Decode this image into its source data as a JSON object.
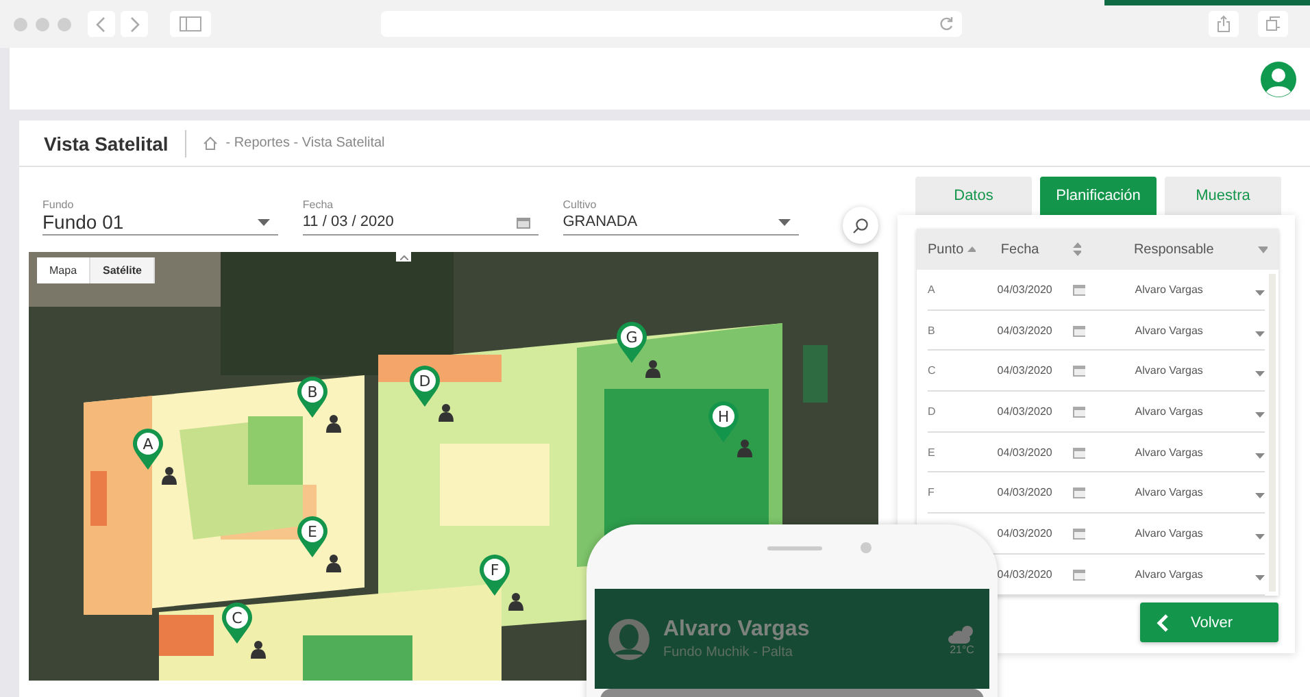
{
  "page": {
    "title": "Vista Satelital",
    "breadcrumb": "- Reportes - Vista Satelital"
  },
  "filters": [
    {
      "label": "Fundo",
      "value": "Fundo 01",
      "kind": "select"
    },
    {
      "label": "Fecha",
      "value": "11 / 03 / 2020",
      "kind": "date"
    },
    {
      "label": "Cultivo",
      "value": "GRANADA",
      "kind": "select"
    }
  ],
  "map": {
    "toggles": [
      {
        "label": "Mapa",
        "selected": false
      },
      {
        "label": "Satélite",
        "selected": true
      }
    ],
    "pins": [
      {
        "label": "A"
      },
      {
        "label": "B"
      },
      {
        "label": "C"
      },
      {
        "label": "D"
      },
      {
        "label": "E"
      },
      {
        "label": "F"
      },
      {
        "label": "G"
      },
      {
        "label": "H"
      }
    ]
  },
  "tabs": [
    {
      "label": "Datos",
      "selected": false
    },
    {
      "label": "Planificación",
      "selected": true
    },
    {
      "label": "Muestra",
      "selected": false
    }
  ],
  "table": {
    "columns": [
      "Punto",
      "Fecha",
      "Responsable"
    ],
    "rows": [
      {
        "punto": "A",
        "fecha": "04/03/2020",
        "responsable": "Alvaro Vargas"
      },
      {
        "punto": "B",
        "fecha": "04/03/2020",
        "responsable": "Alvaro Vargas"
      },
      {
        "punto": "C",
        "fecha": "04/03/2020",
        "responsable": "Alvaro Vargas"
      },
      {
        "punto": "D",
        "fecha": "04/03/2020",
        "responsable": "Alvaro Vargas"
      },
      {
        "punto": "E",
        "fecha": "04/03/2020",
        "responsable": "Alvaro Vargas"
      },
      {
        "punto": "F",
        "fecha": "04/03/2020",
        "responsable": "Alvaro Vargas"
      },
      {
        "fecha": "04/03/2020",
        "responsable": "Alvaro Vargas"
      },
      {
        "fecha": "04/03/2020",
        "responsable": "Alvaro Vargas"
      }
    ]
  },
  "back_button": "Volver",
  "phone": {
    "name": "Alvaro Vargas",
    "subtitle": "Fundo Muchik - Palta",
    "temperature": "21°C"
  }
}
